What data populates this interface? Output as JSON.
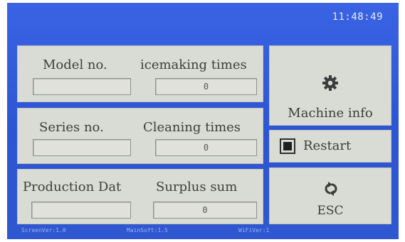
{
  "status": {
    "time": "11:48:49"
  },
  "model": {
    "label": "Model no.",
    "value": ""
  },
  "icemaking": {
    "label": "icemaking times",
    "value": "0"
  },
  "series": {
    "label": "Series no.",
    "value": ""
  },
  "cleaning": {
    "label": "Cleaning times",
    "value": "0"
  },
  "production": {
    "label": "Production Dat",
    "value": ""
  },
  "surplus": {
    "label": "Surplus sum",
    "value": "0"
  },
  "buttons": {
    "machine_info": {
      "label": "Machine info",
      "icon": "gear-icon"
    },
    "restart": {
      "label": "Restart",
      "icon": "stop-square-icon"
    },
    "esc": {
      "label": "ESC",
      "icon": "refresh-arrows-icon"
    }
  },
  "footer": {
    "screen_ver": "ScreenVer:1.0",
    "main_soft": "MainSoft:1.5",
    "wifi_ver": "WiFiVer:1"
  },
  "colors": {
    "background": "#2f59d8",
    "panel": "#d9dcd4",
    "text": "#3b3e3b"
  }
}
